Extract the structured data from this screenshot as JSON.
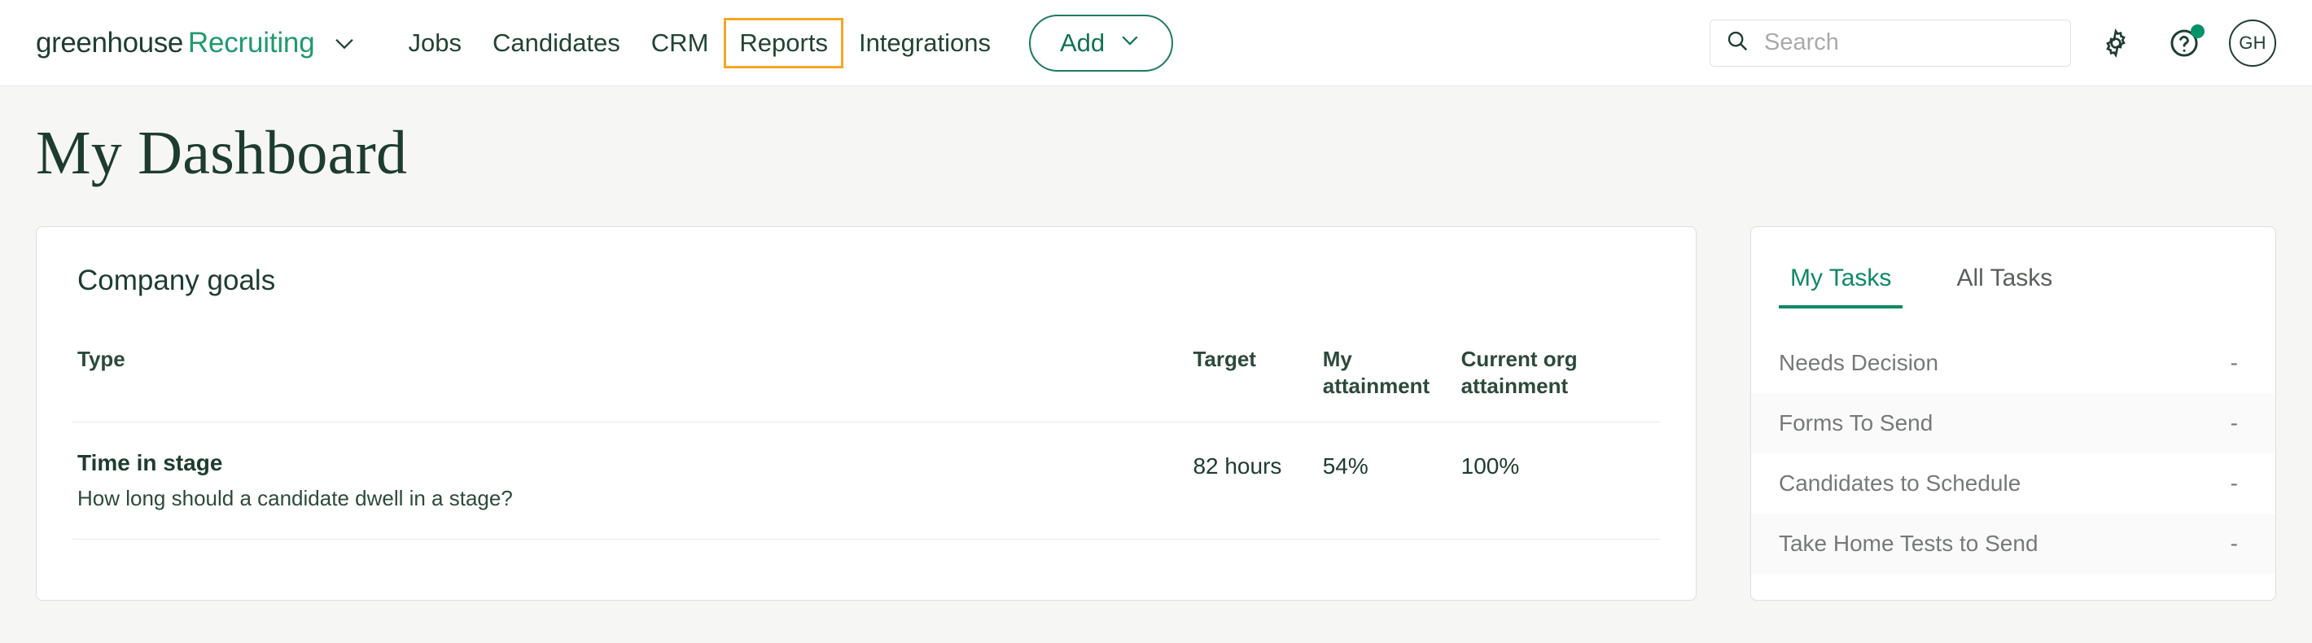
{
  "header": {
    "brand": {
      "word_dark": "greenhouse",
      "word_green": "Recruiting",
      "caret_icon": "chevron-down-icon"
    },
    "nav_items": [
      {
        "label": "Jobs",
        "highlighted": false
      },
      {
        "label": "Candidates",
        "highlighted": false
      },
      {
        "label": "CRM",
        "highlighted": false
      },
      {
        "label": "Reports",
        "highlighted": true
      },
      {
        "label": "Integrations",
        "highlighted": false
      }
    ],
    "add_button": {
      "label": "Add",
      "caret_icon": "chevron-down-icon"
    },
    "search": {
      "placeholder": "Search",
      "value": "",
      "icon": "search-icon"
    },
    "settings_icon": "gear-icon",
    "help_icon": "question-mark-icon",
    "help_has_notification": true,
    "avatar_initials": "GH",
    "colors": {
      "brand_green": "#1f9a6d",
      "nav_text": "#224334",
      "highlight_outline": "#f5a623",
      "notification_dot": "#00926a"
    }
  },
  "page": {
    "title": "My Dashboard",
    "background": "#f6f6f5"
  },
  "goals_card": {
    "title": "Company goals",
    "columns": [
      "Type",
      "Target",
      "My attainment",
      "Current org attainment"
    ],
    "rows": [
      {
        "name": "Time in stage",
        "description": "How long should a candidate dwell in a stage?",
        "target": "82 hours",
        "my_attainment": "54%",
        "org_attainment": "100%"
      }
    ]
  },
  "tasks_card": {
    "tabs": [
      {
        "label": "My Tasks",
        "active": true
      },
      {
        "label": "All Tasks",
        "active": false
      }
    ],
    "rows": [
      {
        "label": "Needs Decision",
        "value": "-"
      },
      {
        "label": "Forms To Send",
        "value": "-"
      },
      {
        "label": "Candidates to Schedule",
        "value": "-"
      },
      {
        "label": "Take Home Tests to Send",
        "value": "-"
      }
    ]
  }
}
